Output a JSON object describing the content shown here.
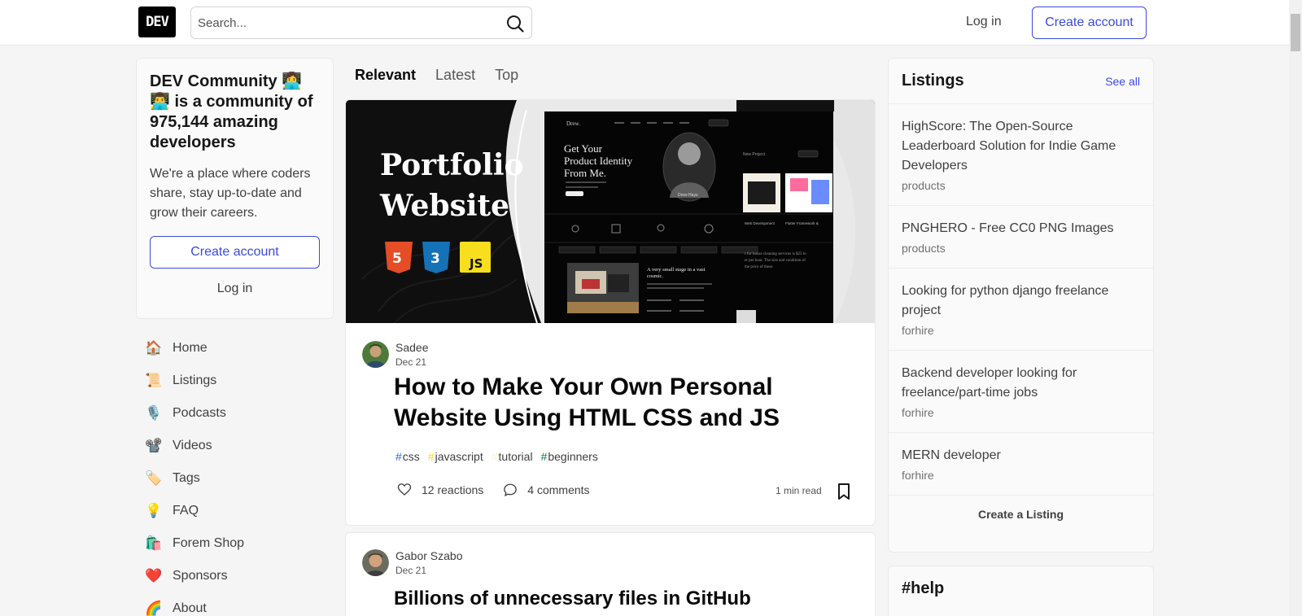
{
  "header": {
    "logo": "DEV",
    "search_placeholder": "Search...",
    "login": "Log in",
    "create_account": "Create account"
  },
  "community": {
    "title": "DEV Community 👩‍💻👨‍💻 is a community of 975,144 amazing developers",
    "description": "We're a place where coders share, stay up-to-date and grow their careers.",
    "create_account": "Create account",
    "login": "Log in"
  },
  "nav": {
    "items": [
      {
        "icon": "🏠",
        "label": "Home"
      },
      {
        "icon": "📜",
        "label": "Listings"
      },
      {
        "icon": "🎙️",
        "label": "Podcasts"
      },
      {
        "icon": "📽️",
        "label": "Videos"
      },
      {
        "icon": "🏷️",
        "label": "Tags"
      },
      {
        "icon": "💡",
        "label": "FAQ"
      },
      {
        "icon": "🛍️",
        "label": "Forem Shop"
      },
      {
        "icon": "❤️",
        "label": "Sponsors"
      },
      {
        "icon": "🌈",
        "label": "About"
      }
    ]
  },
  "feed": {
    "tabs": [
      "Relevant",
      "Latest",
      "Top"
    ],
    "posts": [
      {
        "author": "Sadee",
        "date": "Dec 21",
        "title": "How to Make Your Own Personal Website Using HTML CSS and JS",
        "tags": [
          {
            "name": "css",
            "color": "#2965f1"
          },
          {
            "name": "javascript",
            "color": "#f7df1e"
          },
          {
            "name": "tutorial",
            "color": "#fef5c2"
          },
          {
            "name": "beginners",
            "color": "#008335"
          }
        ],
        "reactions": "12 reactions",
        "comments": "4 comments",
        "read_time": "1 min read",
        "cover": {
          "title_line1": "Portfolio",
          "title_line2": "Website",
          "badges": [
            "5",
            "3",
            "JS"
          ],
          "mock_heading": "Get Your Product Identity From Me.",
          "mock_name": "Drew Hays",
          "mock_brand": "Drew."
        }
      },
      {
        "author": "Gabor Szabo",
        "date": "Dec 21",
        "title": "Billions of unnecessary files in GitHub"
      }
    ]
  },
  "listings": {
    "title": "Listings",
    "see_all": "See all",
    "items": [
      {
        "title": "HighScore: The Open-Source Leaderboard Solution for Indie Game Developers",
        "category": "products"
      },
      {
        "title": "PNGHERO - Free CC0 PNG Images",
        "category": "products"
      },
      {
        "title": "Looking for python django freelance project",
        "category": "forhire"
      },
      {
        "title": "Backend developer looking for freelance/part-time jobs",
        "category": "forhire"
      },
      {
        "title": "MERN developer",
        "category": "forhire"
      }
    ],
    "create": "Create a Listing"
  },
  "help": {
    "title": "#help"
  },
  "colors": {
    "accent": "#3b49df",
    "bg": "#f5f5f5"
  }
}
